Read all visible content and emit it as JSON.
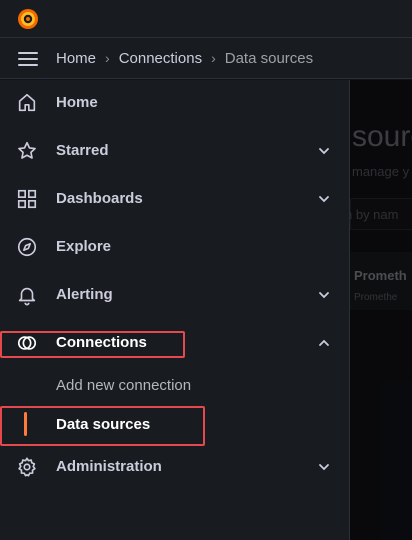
{
  "breadcrumb": {
    "items": [
      {
        "label": "Home"
      },
      {
        "label": "Connections"
      },
      {
        "label": "Data sources"
      }
    ],
    "separator": "›"
  },
  "background_page": {
    "title_fragment": "source",
    "subtitle_fragment": "manage y",
    "search_placeholder_fragment": "h by nam",
    "list_item_title": "Prometh",
    "list_item_subtitle": "Promethe"
  },
  "sidebar": {
    "items": [
      {
        "label": "Home",
        "icon": "home-icon"
      },
      {
        "label": "Starred",
        "icon": "star-icon",
        "expandable": true
      },
      {
        "label": "Dashboards",
        "icon": "dashboards-icon",
        "expandable": true
      },
      {
        "label": "Explore",
        "icon": "compass-icon"
      },
      {
        "label": "Alerting",
        "icon": "bell-icon",
        "expandable": true
      },
      {
        "label": "Connections",
        "icon": "connections-icon",
        "expanded": true
      },
      {
        "label": "Administration",
        "icon": "gear-icon",
        "expandable": true
      }
    ],
    "connections_children": [
      {
        "label": "Add new connection"
      },
      {
        "label": "Data sources",
        "active": true
      }
    ]
  },
  "colors": {
    "background": "#111217",
    "panel": "#181b1f",
    "accent": "#ff7a3d",
    "highlight_box": "#e5484d",
    "text": "#ccccdc"
  }
}
